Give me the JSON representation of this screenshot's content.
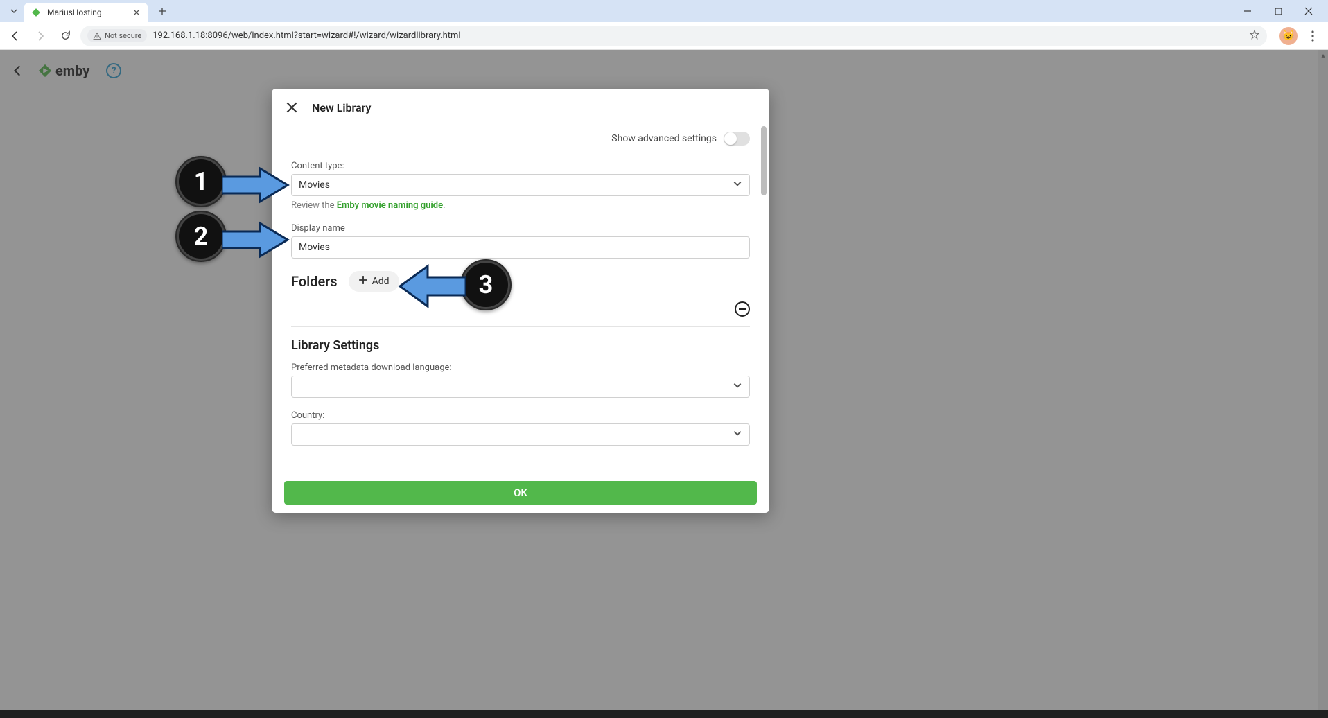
{
  "browser": {
    "tabTitle": "MariusHosting",
    "notSecure": "Not secure",
    "url": "192.168.1.18:8096/web/index.html?start=wizard#!/wizard/wizardlibrary.html"
  },
  "emby": {
    "brand": "emby"
  },
  "modal": {
    "title": "New Library",
    "advancedLabel": "Show advanced settings",
    "contentTypeLabel": "Content type:",
    "contentTypeValue": "Movies",
    "reviewPrefix": "Review the ",
    "reviewLink": "Emby movie naming guide",
    "reviewSuffix": ".",
    "displayNameLabel": "Display name",
    "displayNameValue": "Movies",
    "foldersTitle": "Folders",
    "addLabel": "Add",
    "librarySettingsTitle": "Library Settings",
    "metadataLangLabel": "Preferred metadata download language:",
    "metadataLangValue": "",
    "countryLabel": "Country:",
    "countryValue": "",
    "okLabel": "OK"
  },
  "annotations": {
    "b1": "1",
    "b2": "2",
    "b3": "3"
  }
}
